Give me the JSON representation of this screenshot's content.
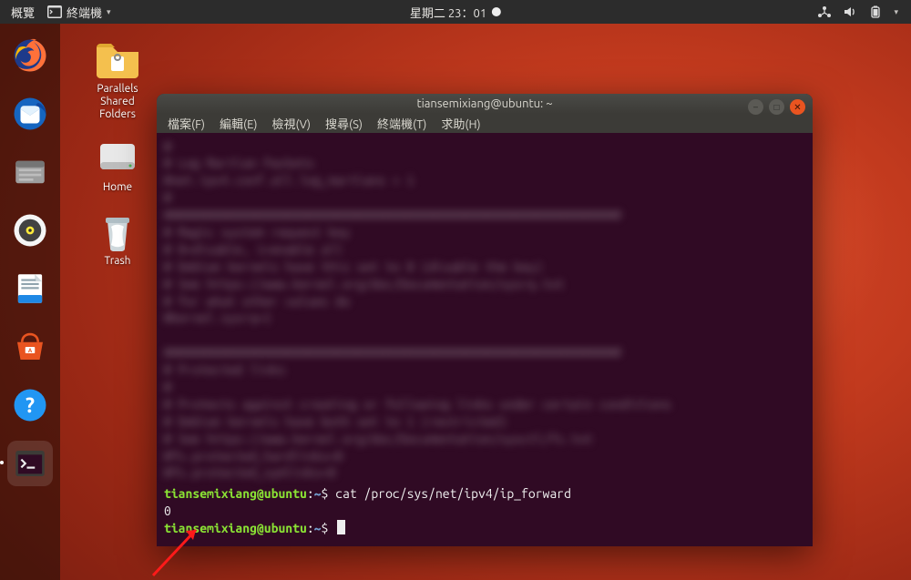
{
  "topbar": {
    "activities_label": "概覽",
    "app_indicator_label": "終端機",
    "clock": "星期二 23：01",
    "tray": {
      "network_icon": "network-icon",
      "volume_icon": "volume-icon",
      "battery_icon": "battery-icon"
    }
  },
  "dock": {
    "items": [
      {
        "name": "firefox",
        "active": false
      },
      {
        "name": "thunderbird",
        "active": false
      },
      {
        "name": "files",
        "active": false
      },
      {
        "name": "rhythmbox",
        "active": false
      },
      {
        "name": "libreoffice-writer",
        "active": false
      },
      {
        "name": "ubuntu-software",
        "active": false
      },
      {
        "name": "help",
        "active": false
      },
      {
        "name": "terminal",
        "active": true
      }
    ]
  },
  "desktop": {
    "icons": [
      {
        "name": "parallels-shared-folders",
        "label": "Parallels\nShared\nFolders"
      },
      {
        "name": "home",
        "label": "Home"
      },
      {
        "name": "trash",
        "label": "Trash"
      }
    ]
  },
  "terminal": {
    "title": "tiansemixiang@ubuntu: ~",
    "menu": {
      "file": "檔案(F)",
      "edit": "編輯(E)",
      "view": "檢視(V)",
      "search": "搜尋(S)",
      "terminal": "終端機(T)",
      "help": "求助(H)"
    },
    "window_controls": {
      "min": "–",
      "max": "□",
      "close": "✕"
    },
    "blurred_placeholder": "#\n# Log Martian Packets\n#net.ipv4.conf.all.log_martians = 1\n#\n################################################################\n# Magic system request key\n# 0=disable, 1=enable all\n# Debian kernels have this set to 0 (disable the key)\n# See https://www.kernel.org/doc/Documentation/sysrq.txt\n# for what other values do\n#kernel.sysrq=1\n\n################################################################\n# Protected links\n#\n# Protects against creating or following links under certain conditions\n# Debian kernels have both set to 1 (restricted)\n# See https://www.kernel.org/doc/Documentation/sysctl/fs.txt\n#fs.protected_hardlinks=0\n#fs.protected_symlinks=0",
    "prompt": {
      "user": "tiansemixiang",
      "at": "@",
      "host": "ubuntu",
      "path": "~",
      "symbol": "$"
    },
    "command": "cat  /proc/sys/net/ipv4/ip_forward",
    "output": "0"
  }
}
